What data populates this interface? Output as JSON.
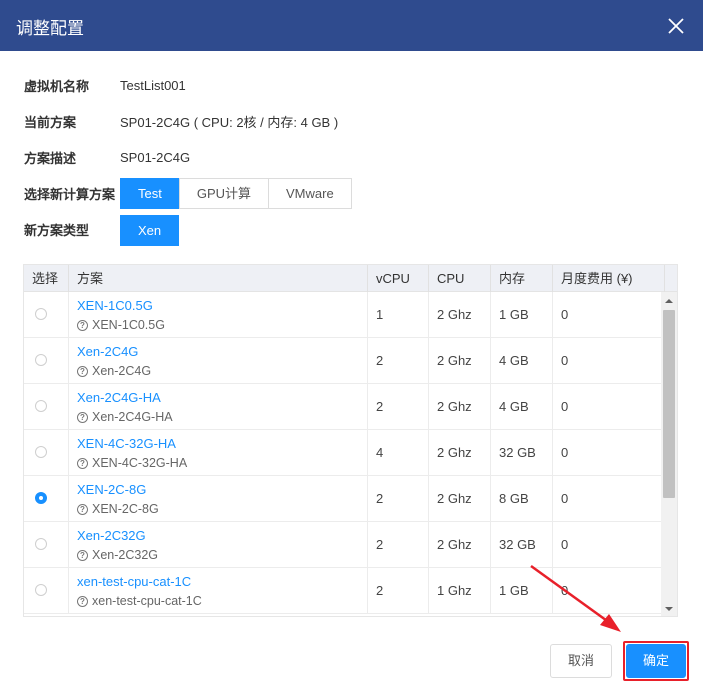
{
  "dialog": {
    "title": "调整配置",
    "close_icon": "close-icon",
    "header_color": "#2f4b8e"
  },
  "form": {
    "vm_name_label": "虚拟机名称",
    "vm_name_value": "TestList001",
    "current_plan_label": "当前方案",
    "current_plan_value": "SP01-2C4G ( CPU: 2核 / 内存: 4 GB )",
    "plan_desc_label": "方案描述",
    "plan_desc_value": "SP01-2C4G",
    "select_plan_label": "选择新计算方案",
    "compute_options": [
      "Test",
      "GPU计算",
      "VMware"
    ],
    "compute_selected": "Test",
    "new_type_label": "新方案类型",
    "type_options": [
      "Xen"
    ],
    "type_selected": "Xen"
  },
  "table": {
    "headers": [
      "选择",
      "方案",
      "vCPU",
      "CPU",
      "内存",
      "月度费用 (¥)"
    ],
    "rows": [
      {
        "name": "XEN-1C0.5G",
        "desc": "XEN-1C0.5G",
        "vcpu": "1",
        "cpu": "2 Ghz",
        "mem": "1 GB",
        "fee": "0",
        "selected": false
      },
      {
        "name": "Xen-2C4G",
        "desc": "Xen-2C4G",
        "vcpu": "2",
        "cpu": "2 Ghz",
        "mem": "4 GB",
        "fee": "0",
        "selected": false
      },
      {
        "name": "Xen-2C4G-HA",
        "desc": "Xen-2C4G-HA",
        "vcpu": "2",
        "cpu": "2 Ghz",
        "mem": "4 GB",
        "fee": "0",
        "selected": false
      },
      {
        "name": "XEN-4C-32G-HA",
        "desc": "XEN-4C-32G-HA",
        "vcpu": "4",
        "cpu": "2 Ghz",
        "mem": "32 GB",
        "fee": "0",
        "selected": false
      },
      {
        "name": "XEN-2C-8G",
        "desc": "XEN-2C-8G",
        "vcpu": "2",
        "cpu": "2 Ghz",
        "mem": "8 GB",
        "fee": "0",
        "selected": true
      },
      {
        "name": "Xen-2C32G",
        "desc": "Xen-2C32G",
        "vcpu": "2",
        "cpu": "2 Ghz",
        "mem": "32 GB",
        "fee": "0",
        "selected": false
      },
      {
        "name": "xen-test-cpu-cat-1C",
        "desc": "xen-test-cpu-cat-1C",
        "vcpu": "2",
        "cpu": "1 Ghz",
        "mem": "1 GB",
        "fee": "0",
        "selected": false
      }
    ]
  },
  "footer": {
    "cancel_label": "取消",
    "ok_label": "确定"
  },
  "colors": {
    "accent": "#1890ff",
    "annotation": "#e8202a"
  }
}
